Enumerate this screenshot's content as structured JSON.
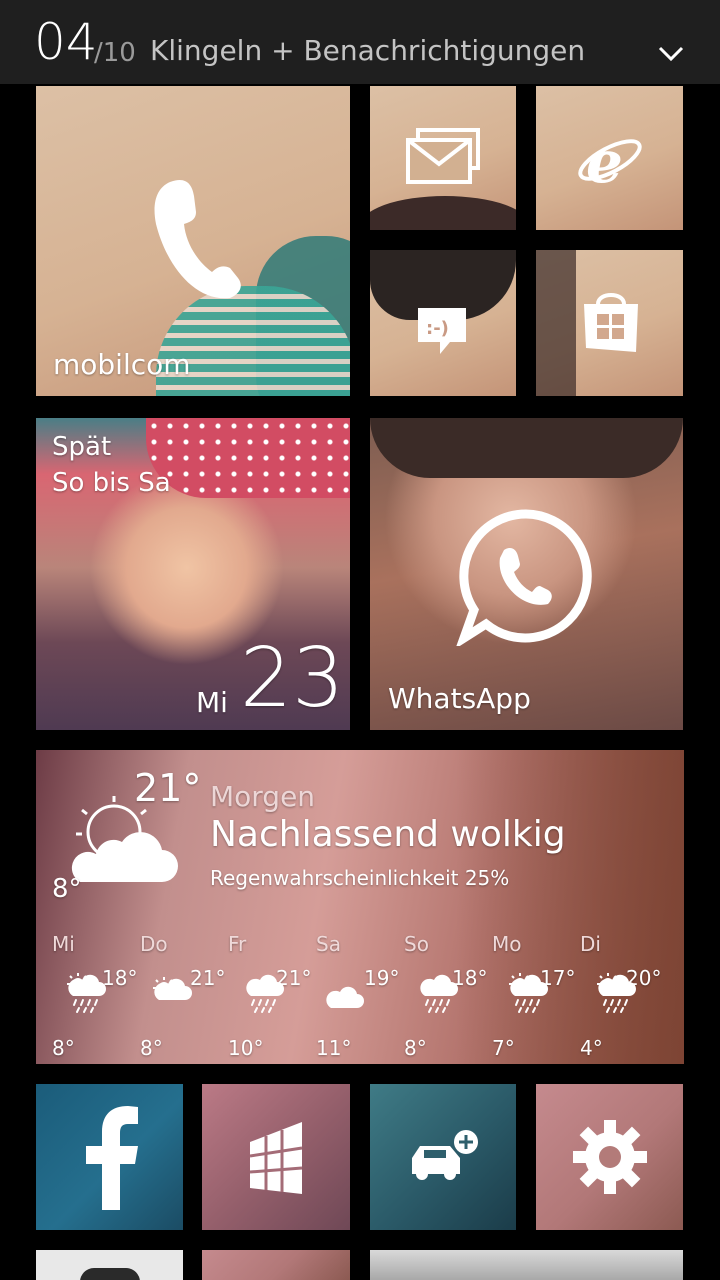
{
  "header": {
    "page_current": "04",
    "page_total": "/10",
    "title": "Klingeln + Benachrichtigungen"
  },
  "tiles": {
    "phone": {
      "label": "mobilcom"
    },
    "calendar": {
      "line1": "Spät",
      "line2": "So bis Sa",
      "weekday": "Mi",
      "day": "23"
    },
    "whatsapp": {
      "label": "WhatsApp"
    }
  },
  "weather": {
    "current": {
      "high": "21°",
      "low": "8°"
    },
    "heading": "Morgen",
    "condition": "Nachlassend wolkig",
    "rain": "Regenwahrscheinlichkeit 25%",
    "days": [
      {
        "name": "Mi",
        "high": "18°",
        "low": "8°",
        "icon": "sun-rain-icon"
      },
      {
        "name": "Do",
        "high": "21°",
        "low": "8°",
        "icon": "sun-cloud-icon"
      },
      {
        "name": "Fr",
        "high": "21°",
        "low": "10°",
        "icon": "rain-icon"
      },
      {
        "name": "Sa",
        "high": "19°",
        "low": "11°",
        "icon": "cloud-icon"
      },
      {
        "name": "So",
        "high": "18°",
        "low": "8°",
        "icon": "rain-icon"
      },
      {
        "name": "Mo",
        "high": "17°",
        "low": "7°",
        "icon": "sun-rain-icon"
      },
      {
        "name": "Di",
        "high": "20°",
        "low": "4°",
        "icon": "sun-rain-icon"
      }
    ]
  },
  "colors": {
    "top_bar": "#1f1f1f",
    "background": "#000000",
    "icon": "#ffffff",
    "secondary_text": "#c4c4c4"
  }
}
